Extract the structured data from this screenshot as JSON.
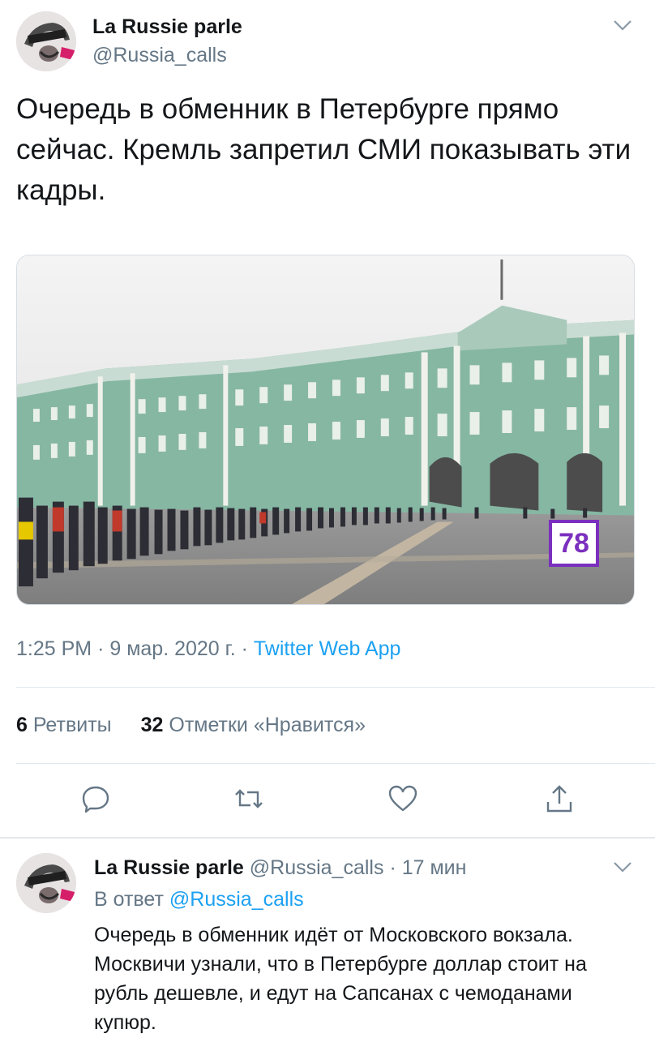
{
  "tweet": {
    "author_name": "La Russie parle",
    "author_handle": "@Russia_calls",
    "text": "Очередь в обменник в Петербурге прямо сейчас. Кремль запретил СМИ показывать эти кадры.",
    "media": {
      "channel_badge": "78"
    },
    "time": "1:25 PM",
    "date": "9 мар. 2020 г.",
    "separator": "·",
    "source_app": "Twitter Web App",
    "stats": {
      "retweets_count": "6",
      "retweets_label": "Ретвиты",
      "likes_count": "32",
      "likes_label": "Отметки «Нравится»"
    },
    "actions": [
      "reply-icon",
      "retweet-icon",
      "like-icon",
      "share-icon"
    ]
  },
  "reply": {
    "author_name": "La Russie parle",
    "author_handle": "@Russia_calls",
    "separator": "·",
    "time_ago": "17 мин",
    "in_reply_prefix": "В ответ",
    "in_reply_handle": "@Russia_calls",
    "text": "Очередь в обменник идёт от Московского вокзала. Москвичи узнали, что в Петербурге доллар стоит на рубль дешевле, и едут на Сапсанах с чемоданами купюр."
  },
  "colors": {
    "accent": "#1da1f2",
    "secondary_text": "#657786",
    "divider": "#e1e8ed",
    "badge": "#7b2fbe"
  }
}
